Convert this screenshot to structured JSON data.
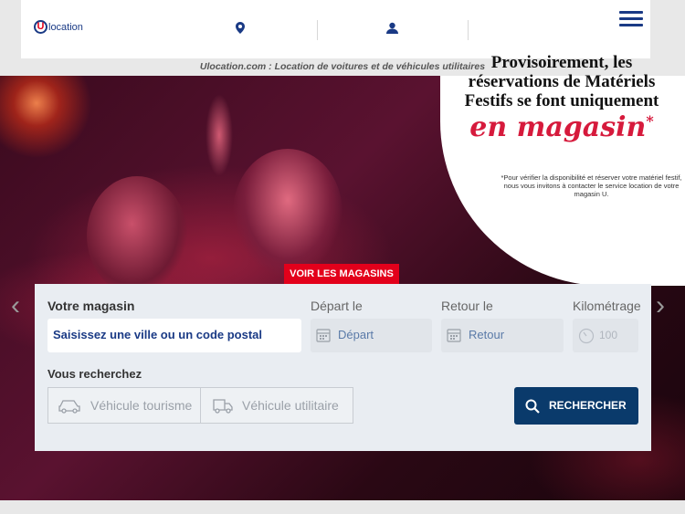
{
  "header": {
    "logo_text": "location",
    "logo_letter": "U",
    "icons": [
      "map-pin-icon",
      "user-icon",
      "menu-icon"
    ]
  },
  "tagline": "Ulocation.com : Location de voitures et de véhicules utilitaires",
  "promo": {
    "title": "Provisoirement, les réservations de Matériels Festifs se font uniquement",
    "script": "en magasin",
    "asterisk": "*",
    "note": "*Pour vérifier la disponibilité et réserver votre matériel festif, nous vous invitons à contacter le service location de votre magasin U.",
    "button": "VOIR LES MAGASINS"
  },
  "search": {
    "store_label": "Votre magasin",
    "store_value": "Saisissez une ville ou un code postal",
    "depart_label": "Départ le",
    "depart_placeholder": "Départ",
    "retour_label": "Retour le",
    "retour_placeholder": "Retour",
    "km_label": "Kilométrage",
    "km_placeholder": "100",
    "vehicle_label": "Vous recherchez",
    "vehicle_options": [
      "Véhicule tourisme",
      "Véhicule utilitaire"
    ],
    "search_button": "RECHERCHER"
  },
  "colors": {
    "brand_blue": "#1a3a85",
    "brand_red": "#e3001b",
    "button_blue": "#0a3a6b"
  }
}
